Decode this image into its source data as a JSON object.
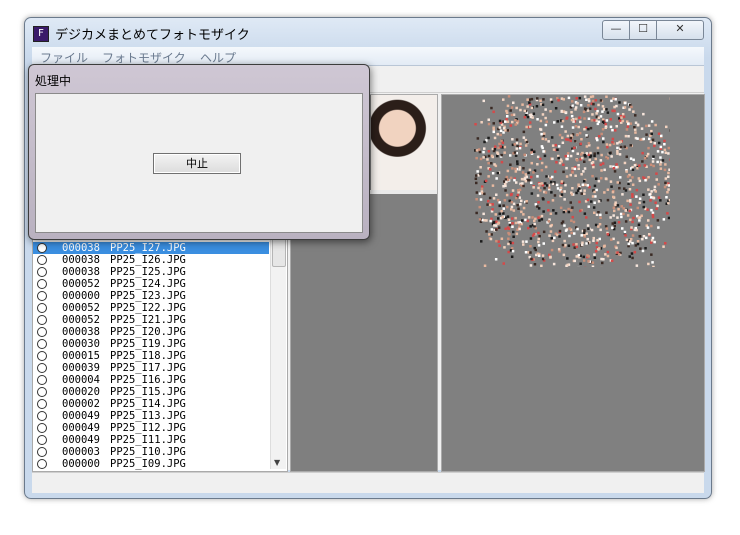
{
  "window": {
    "title": "デジカメまとめてフォトモザイク",
    "icon_letter": "F",
    "min_glyph": "—",
    "max_glyph": "☐",
    "close_glyph": "✕"
  },
  "menu": [
    "ファイル",
    "フォトモザイク",
    "ヘルプ"
  ],
  "file_list": [
    {
      "count": "000038",
      "name": "PP25_I27.JPG",
      "selected": true
    },
    {
      "count": "000038",
      "name": "PP25_I26.JPG"
    },
    {
      "count": "000038",
      "name": "PP25_I25.JPG"
    },
    {
      "count": "000052",
      "name": "PP25_I24.JPG"
    },
    {
      "count": "000000",
      "name": "PP25_I23.JPG"
    },
    {
      "count": "000052",
      "name": "PP25_I22.JPG"
    },
    {
      "count": "000052",
      "name": "PP25_I21.JPG"
    },
    {
      "count": "000038",
      "name": "PP25_I20.JPG"
    },
    {
      "count": "000030",
      "name": "PP25_I19.JPG"
    },
    {
      "count": "000015",
      "name": "PP25_I18.JPG"
    },
    {
      "count": "000039",
      "name": "PP25_I17.JPG"
    },
    {
      "count": "000004",
      "name": "PP25_I16.JPG"
    },
    {
      "count": "000020",
      "name": "PP25_I15.JPG"
    },
    {
      "count": "000002",
      "name": "PP25_I14.JPG"
    },
    {
      "count": "000049",
      "name": "PP25_I13.JPG"
    },
    {
      "count": "000049",
      "name": "PP25_I12.JPG"
    },
    {
      "count": "000049",
      "name": "PP25_I11.JPG"
    },
    {
      "count": "000003",
      "name": "PP25_I10.JPG"
    },
    {
      "count": "000000",
      "name": "PP25_I09.JPG"
    }
  ],
  "dialog": {
    "title": "処理中",
    "stop_button": "中止"
  },
  "colors": {
    "selection": "#3a8ee0",
    "panel_gray": "#808080"
  }
}
